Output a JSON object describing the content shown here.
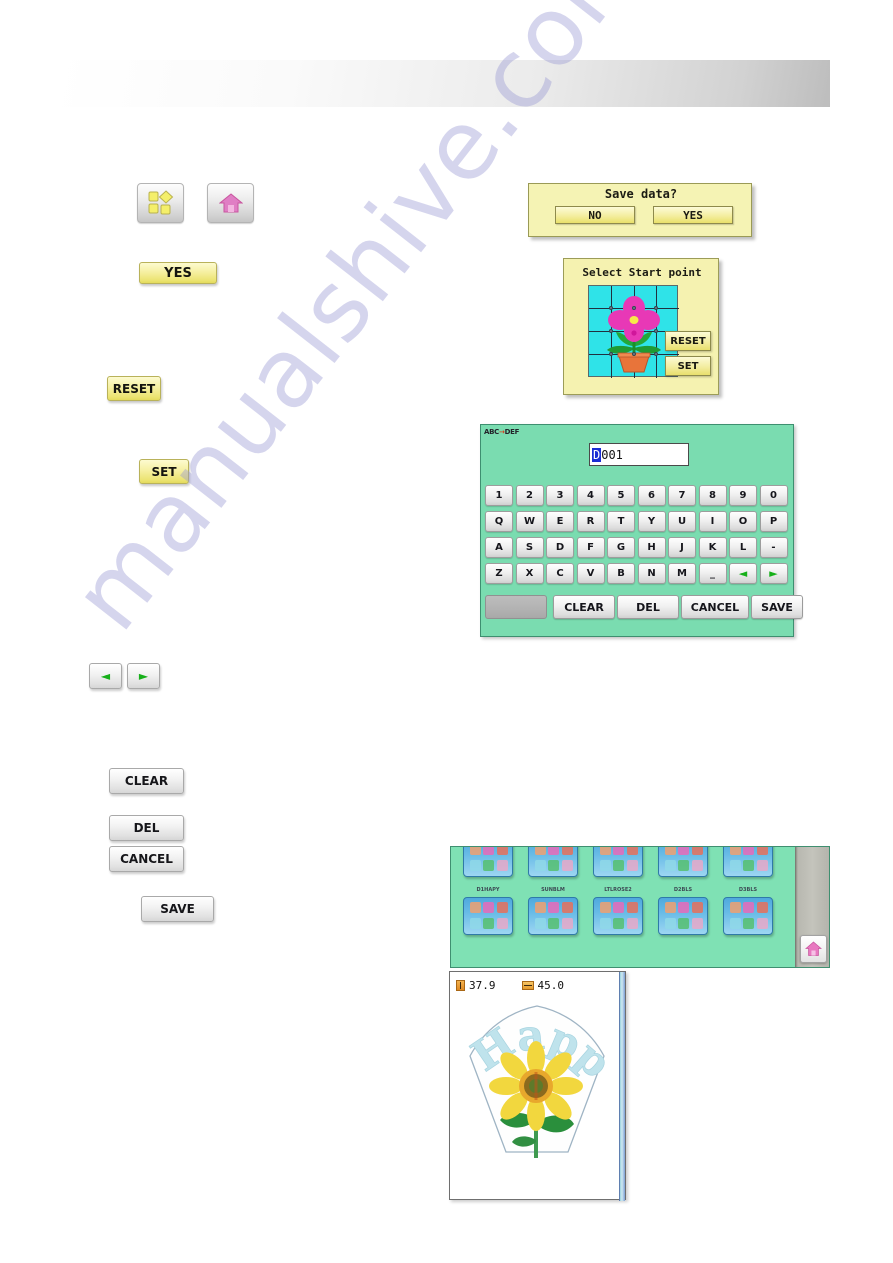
{
  "page": {
    "watermark": "manualshive.com",
    "header_bar": ""
  },
  "left_buttons": {
    "pattern_icon_label": "pattern-shapes-icon",
    "home_icon_label": "home-icon",
    "yes": "YES",
    "reset": "RESET",
    "set": "SET",
    "arrow_left": "◄",
    "arrow_right": "►",
    "clear": "CLEAR",
    "del": "DEL",
    "cancel": "CANCEL",
    "save": "SAVE"
  },
  "save_dialog": {
    "title": "Save data?",
    "no": "NO",
    "yes": "YES"
  },
  "start_point_panel": {
    "title": "Select Start point",
    "reset": "RESET",
    "set": "SET",
    "grid_bg_color": "#2fe3e8",
    "panel_bg_color": "#f5f2b0",
    "flower_color": "#e838b6",
    "pot_color": "#e8743a",
    "leaf_color": "#1f9b33"
  },
  "keyboard_screen": {
    "mode_label_left": "ABC",
    "mode_label_arrow": "→",
    "mode_label_right": "DEF",
    "field_value": "D001",
    "field_selected_char": "D",
    "field_rest": "001",
    "screen_bg_color": "#7adcb0",
    "rows": [
      [
        "1",
        "2",
        "3",
        "4",
        "5",
        "6",
        "7",
        "8",
        "9",
        "0"
      ],
      [
        "Q",
        "W",
        "E",
        "R",
        "T",
        "Y",
        "U",
        "I",
        "O",
        "P"
      ],
      [
        "A",
        "S",
        "D",
        "F",
        "G",
        "H",
        "J",
        "K",
        "L",
        "-"
      ],
      [
        "Z",
        "X",
        "C",
        "V",
        "B",
        "N",
        "M",
        "_",
        "◄",
        "►"
      ]
    ],
    "function_keys": [
      "CLEAR",
      "DEL",
      "CANCEL",
      "SAVE"
    ],
    "space_key_label": ""
  },
  "design_list": {
    "screen_bg_color": "#7fe1b4",
    "row1_labels": [
      "",
      "",
      "",
      "",
      ""
    ],
    "row2_labels": [
      "D1HAPY",
      "SUNBLM",
      "LTLROSE2",
      "D2BLS",
      "D3BLS"
    ],
    "home_icon_label": "home-icon"
  },
  "preview": {
    "height_value": "37.9",
    "width_value": "45.0",
    "design_text": "Happy",
    "text_color": "#b8dfe8",
    "flower_color": "#f4d93c",
    "leaf_color": "#2a8f3c"
  }
}
